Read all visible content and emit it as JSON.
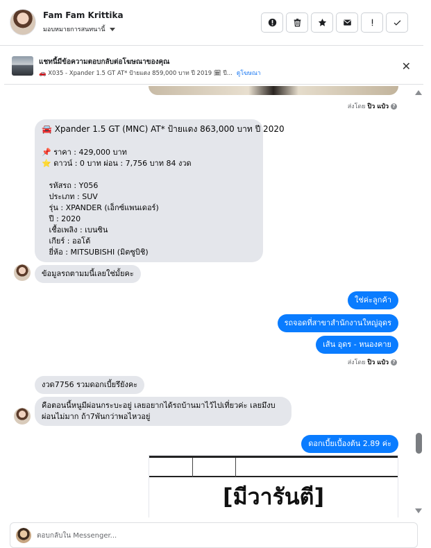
{
  "header": {
    "contact_name": "Fam Fam Krittika",
    "assign_label": "มอบหมายการสนทนานี้",
    "actions": [
      {
        "name": "report-button",
        "icon": "exclamation-circle-icon",
        "glyph": "!"
      },
      {
        "name": "delete-button",
        "icon": "trash-icon",
        "glyph": ""
      },
      {
        "name": "star-button",
        "icon": "star-icon",
        "glyph": "★"
      },
      {
        "name": "mark-unread-button",
        "icon": "envelope-icon",
        "glyph": ""
      },
      {
        "name": "follow-up-button",
        "icon": "exclamation-icon",
        "glyph": "!"
      },
      {
        "name": "mark-done-button",
        "icon": "check-icon",
        "glyph": "✓"
      }
    ]
  },
  "ad": {
    "title": "แชทนี้มีข้อความตอบกลับต่อโฆษณาของคุณ",
    "subtitle": "🚗 X035 - Xpander 1.5 GT AT* ป้ายแดง 859,000 บาท ปี 2019 🗓 ปี...",
    "link_label": "ดูโฆษณา",
    "close_glyph": "✕"
  },
  "messages": {
    "sent_by_prefix": "ส่งโดย",
    "sent_by_name": "ปิว แป๋ว",
    "big_message_lines": [
      "🚘 Xpander 1.5 GT (MNC) AT* ป้ายแดง 863,000 บาท ปี 2020",
      "",
      "📌 ราคา : 429,000 บาท",
      "⭐ ดาวน์ : 0 บาท ผ่อน : 7,756 บาท 84 งวด",
      "",
      "   รหัสรถ : Y056",
      "   ประเภท : SUV",
      "   รุ่น : XPANDER (เอ็กซ์แพนเดอร์)",
      "   ปี : 2020",
      "   เชื้อเพลิง : เบนซิน",
      "   เกียร์ : ออโต้",
      "   ยี่ห้อ : MITSUBISHI (มิตซูบิชิ)"
    ],
    "customer_q1": "ข้อมูลรถตามมนี้เลยใช่มั้ยคะ",
    "reply_1": "ใช่ค่ะลูกค้า",
    "reply_2": "รถจอดที่สาขาสำนักงานใหญ่อุดร",
    "reply_3": "เส้น อุดร - หนองคาย",
    "customer_q2": "งวด7756 รวมดอกเบี้ยรึยังคะ",
    "customer_q3_line1": "คือตอนนี้หนูมีผ่อนกระบะอยู่ เลยอยากได้รถบ้านมาไว้ไปเที่ยวค่ะ เลยมึงบ",
    "customer_q3_line2": "ผ่อนไม่มาก ถ้า7พันกว่าพอไหวอยู่",
    "reply_4": "ดอกเบี้ยเบื้องต้น  2.89 ค่ะ",
    "image_text": "[มีวารันตี]"
  },
  "composer": {
    "placeholder": "ตอบกลับใน Messenger..."
  }
}
